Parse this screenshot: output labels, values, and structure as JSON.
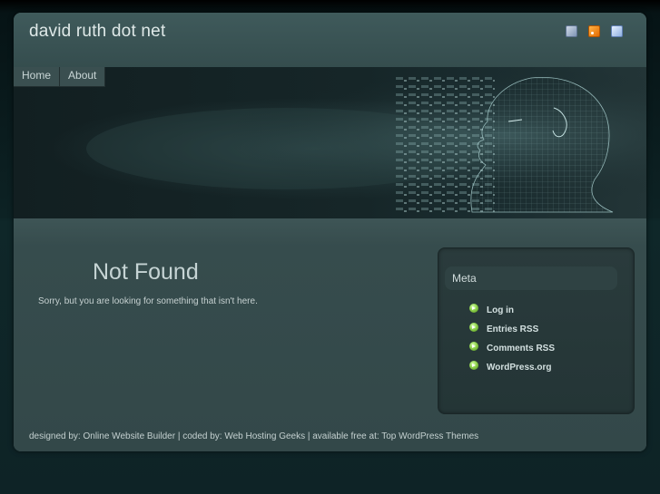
{
  "header": {
    "site_title": "david ruth dot net",
    "icons": [
      "mail-icon",
      "rss-icon",
      "bookmark-icon"
    ]
  },
  "nav": {
    "items": [
      {
        "label": "Home"
      },
      {
        "label": "About"
      }
    ]
  },
  "main": {
    "title": "Not Found",
    "message": "Sorry, but you are looking for something that isn't here."
  },
  "sidebar": {
    "widget_title": "Meta",
    "links": [
      {
        "label": "Log in"
      },
      {
        "label": "Entries RSS"
      },
      {
        "label": "Comments RSS"
      },
      {
        "label": "WordPress.org"
      }
    ]
  },
  "footer": {
    "prefix": "designed by: ",
    "link1": "Online Website Builder",
    "sep1": " | coded by: ",
    "link2": "Web Hosting Geeks",
    "sep2": " | available free at: ",
    "link3": "Top WordPress Themes"
  },
  "colors": {
    "page_background": "#0c1c1e",
    "panel": "#344a4b",
    "text": "#c6d4d4",
    "bullet": "#8ed14c"
  }
}
